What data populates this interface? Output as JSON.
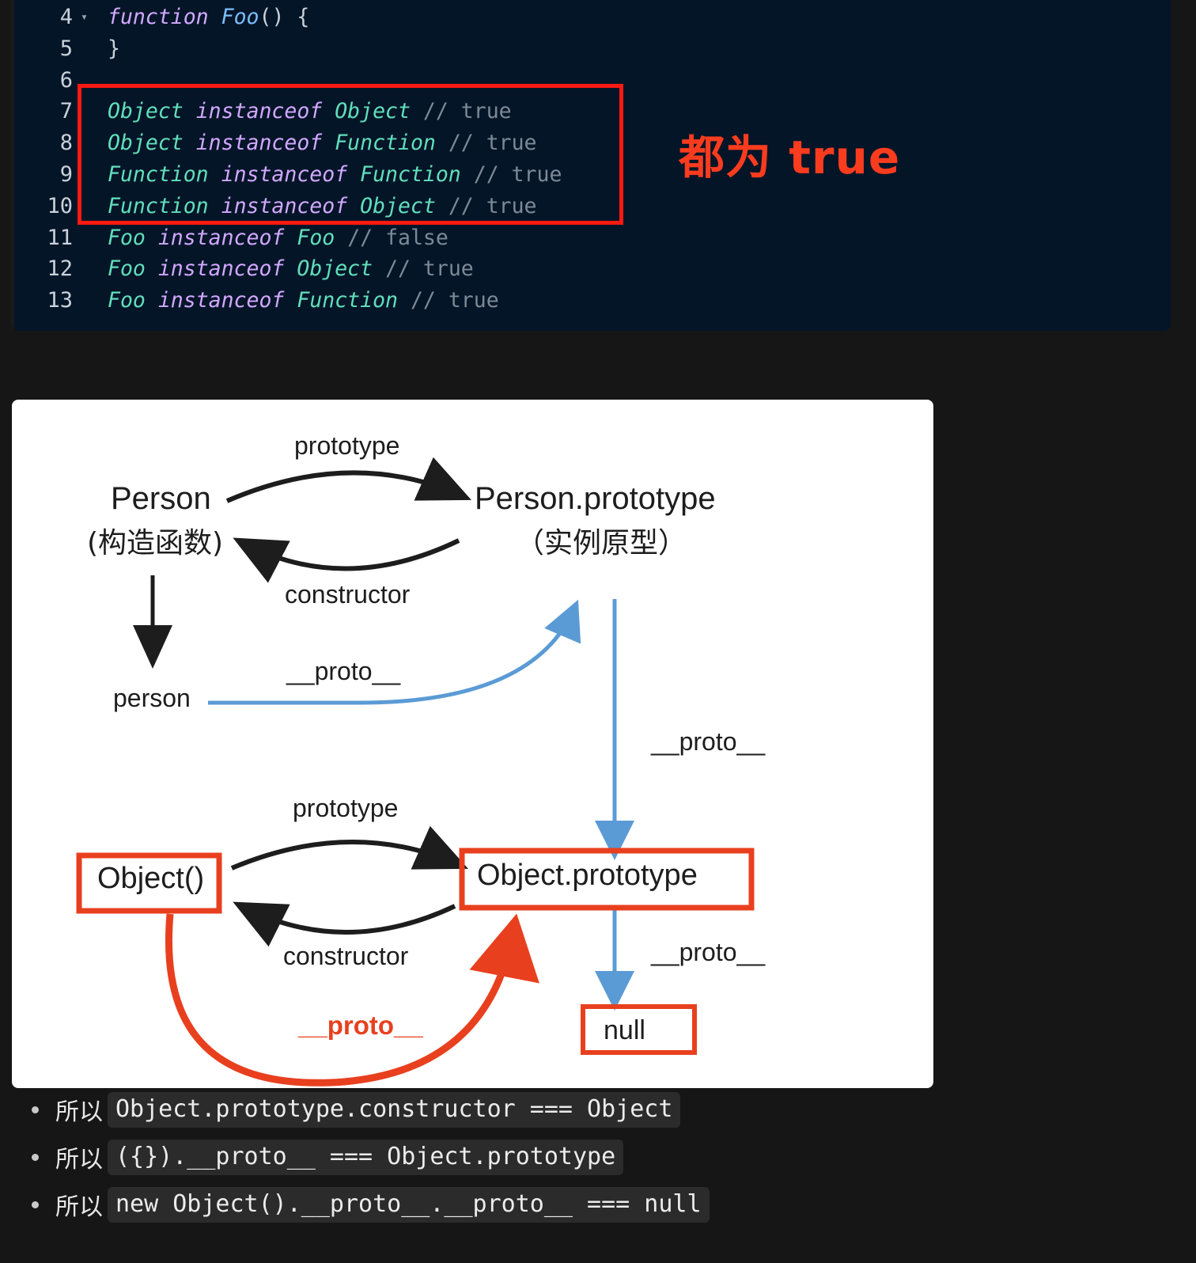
{
  "code_block": {
    "language_theme_bg": "#041528",
    "lines": [
      {
        "num": "4",
        "fold": "▾",
        "tokens": [
          {
            "t": "function",
            "c": "kw"
          },
          {
            "t": " ",
            "c": "punc"
          },
          {
            "t": "Foo",
            "c": "fn"
          },
          {
            "t": "() {",
            "c": "punc"
          }
        ]
      },
      {
        "num": "5",
        "fold": "",
        "tokens": [
          {
            "t": "}",
            "c": "punc"
          }
        ]
      },
      {
        "num": "6",
        "fold": "",
        "tokens": []
      },
      {
        "num": "7",
        "fold": "",
        "tokens": [
          {
            "t": "Object",
            "c": "type"
          },
          {
            "t": " ",
            "c": "punc"
          },
          {
            "t": "instanceof",
            "c": "kw"
          },
          {
            "t": " ",
            "c": "punc"
          },
          {
            "t": "Object",
            "c": "type"
          },
          {
            "t": " ",
            "c": "punc"
          },
          {
            "t": "// true",
            "c": "com"
          }
        ]
      },
      {
        "num": "8",
        "fold": "",
        "tokens": [
          {
            "t": "Object",
            "c": "type"
          },
          {
            "t": " ",
            "c": "punc"
          },
          {
            "t": "instanceof",
            "c": "kw"
          },
          {
            "t": " ",
            "c": "punc"
          },
          {
            "t": "Function",
            "c": "type"
          },
          {
            "t": " ",
            "c": "punc"
          },
          {
            "t": "// true",
            "c": "com"
          }
        ]
      },
      {
        "num": "9",
        "fold": "",
        "tokens": [
          {
            "t": "Function",
            "c": "type"
          },
          {
            "t": " ",
            "c": "punc"
          },
          {
            "t": "instanceof",
            "c": "kw"
          },
          {
            "t": " ",
            "c": "punc"
          },
          {
            "t": "Function",
            "c": "type"
          },
          {
            "t": " ",
            "c": "punc"
          },
          {
            "t": "// true",
            "c": "com"
          }
        ]
      },
      {
        "num": "10",
        "fold": "",
        "tokens": [
          {
            "t": "Function",
            "c": "type"
          },
          {
            "t": " ",
            "c": "punc"
          },
          {
            "t": "instanceof",
            "c": "kw"
          },
          {
            "t": " ",
            "c": "punc"
          },
          {
            "t": "Object",
            "c": "type"
          },
          {
            "t": " ",
            "c": "punc"
          },
          {
            "t": "// true",
            "c": "com"
          }
        ]
      },
      {
        "num": "11",
        "fold": "",
        "tokens": [
          {
            "t": "Foo",
            "c": "type"
          },
          {
            "t": " ",
            "c": "punc"
          },
          {
            "t": "instanceof",
            "c": "kw"
          },
          {
            "t": " ",
            "c": "punc"
          },
          {
            "t": "Foo",
            "c": "type"
          },
          {
            "t": " ",
            "c": "punc"
          },
          {
            "t": "// false",
            "c": "com"
          }
        ]
      },
      {
        "num": "12",
        "fold": "",
        "tokens": [
          {
            "t": "Foo",
            "c": "type"
          },
          {
            "t": " ",
            "c": "punc"
          },
          {
            "t": "instanceof",
            "c": "kw"
          },
          {
            "t": " ",
            "c": "punc"
          },
          {
            "t": "Object",
            "c": "type"
          },
          {
            "t": " ",
            "c": "punc"
          },
          {
            "t": "// true",
            "c": "com"
          }
        ]
      },
      {
        "num": "13",
        "fold": "",
        "tokens": [
          {
            "t": "Foo",
            "c": "type"
          },
          {
            "t": " ",
            "c": "punc"
          },
          {
            "t": "instanceof",
            "c": "kw"
          },
          {
            "t": " ",
            "c": "punc"
          },
          {
            "t": "Function",
            "c": "type"
          },
          {
            "t": " ",
            "c": "punc"
          },
          {
            "t": "// true",
            "c": "com"
          }
        ]
      }
    ],
    "highlight_box_color": "#ff1a11",
    "annotation": {
      "text": "都为 true",
      "color": "#fa3c1e"
    }
  },
  "diagram": {
    "colors": {
      "black": "#1d1d1d",
      "blue": "#5b9bd5",
      "red": "#e8401f"
    },
    "labels": {
      "prototype_top": "prototype",
      "constructor_top": "constructor",
      "person": "Person",
      "person_cn": "(构造函数)",
      "person_prototype": "Person.prototype",
      "person_prototype_cn": "（实例原型）",
      "person_instance": "person",
      "proto_top": "__proto__",
      "proto_right_upper": "__proto__",
      "prototype_bottom": "prototype",
      "constructor_bottom": "constructor",
      "object_ctor": "Object()",
      "object_prototype": "Object.prototype",
      "proto_red": "__proto__",
      "proto_right_lower": "__proto__",
      "null_box": "null"
    }
  },
  "bullets": [
    {
      "prefix": "所以",
      "code": "Object.prototype.constructor === Object"
    },
    {
      "prefix": "所以",
      "code": "({}).__proto__ === Object.prototype"
    },
    {
      "prefix": "所以",
      "code": "new Object().__proto__.__proto__ === null"
    }
  ]
}
